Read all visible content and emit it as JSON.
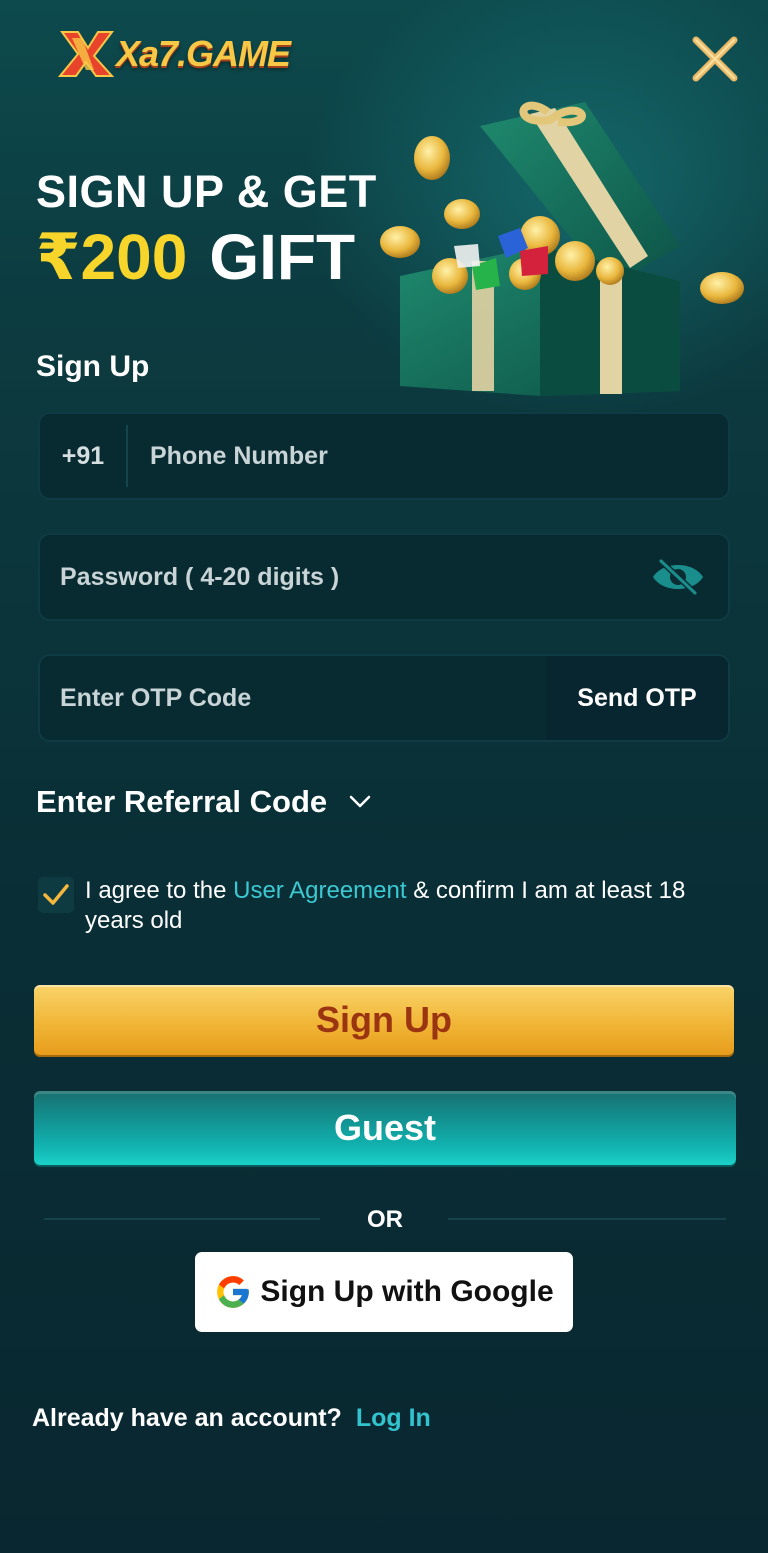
{
  "brand": {
    "logo_text": "Xa7.GAME"
  },
  "promo": {
    "line1": "SIGN UP & GET",
    "amount": "₹200",
    "gift": "GIFT"
  },
  "form": {
    "title": "Sign Up",
    "country_code": "+91",
    "phone_placeholder": "Phone Number",
    "password_placeholder": "Password ( 4-20 digits )",
    "otp_placeholder": "Enter OTP Code",
    "send_otp_label": "Send OTP",
    "referral_label": "Enter Referral Code"
  },
  "agreement": {
    "checked": true,
    "prefix": "I agree to the ",
    "link": "User Agreement",
    "suffix": " & confirm I am at least 18 years old"
  },
  "buttons": {
    "signup_label": "Sign Up",
    "guest_label": "Guest",
    "or_text": "OR",
    "google_label": "Sign Up with Google"
  },
  "login": {
    "question": "Already have an account?",
    "link": "Log In"
  },
  "icons": {
    "close": "close-icon",
    "eye": "eye-off-icon",
    "chevron": "chevron-down-icon",
    "check": "check-icon",
    "google": "google-icon"
  },
  "colors": {
    "accent_gold": "#f1b637",
    "accent_teal": "#12b3b0",
    "link": "#3cc8d2"
  }
}
